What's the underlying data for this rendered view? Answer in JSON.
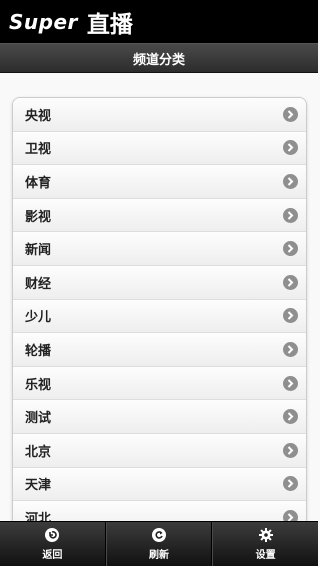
{
  "header": {
    "logo_latin": "Super",
    "logo_cjk": "直播"
  },
  "title_bar": {
    "title": "频道分类"
  },
  "categories": [
    {
      "label": "央视"
    },
    {
      "label": "卫视"
    },
    {
      "label": "体育"
    },
    {
      "label": "影视"
    },
    {
      "label": "新闻"
    },
    {
      "label": "财经"
    },
    {
      "label": "少儿"
    },
    {
      "label": "轮播"
    },
    {
      "label": "乐视"
    },
    {
      "label": "测试"
    },
    {
      "label": "北京"
    },
    {
      "label": "天津"
    },
    {
      "label": "河北"
    }
  ],
  "toolbar": {
    "back_label": "返回",
    "refresh_label": "刷新",
    "settings_label": "设置"
  }
}
